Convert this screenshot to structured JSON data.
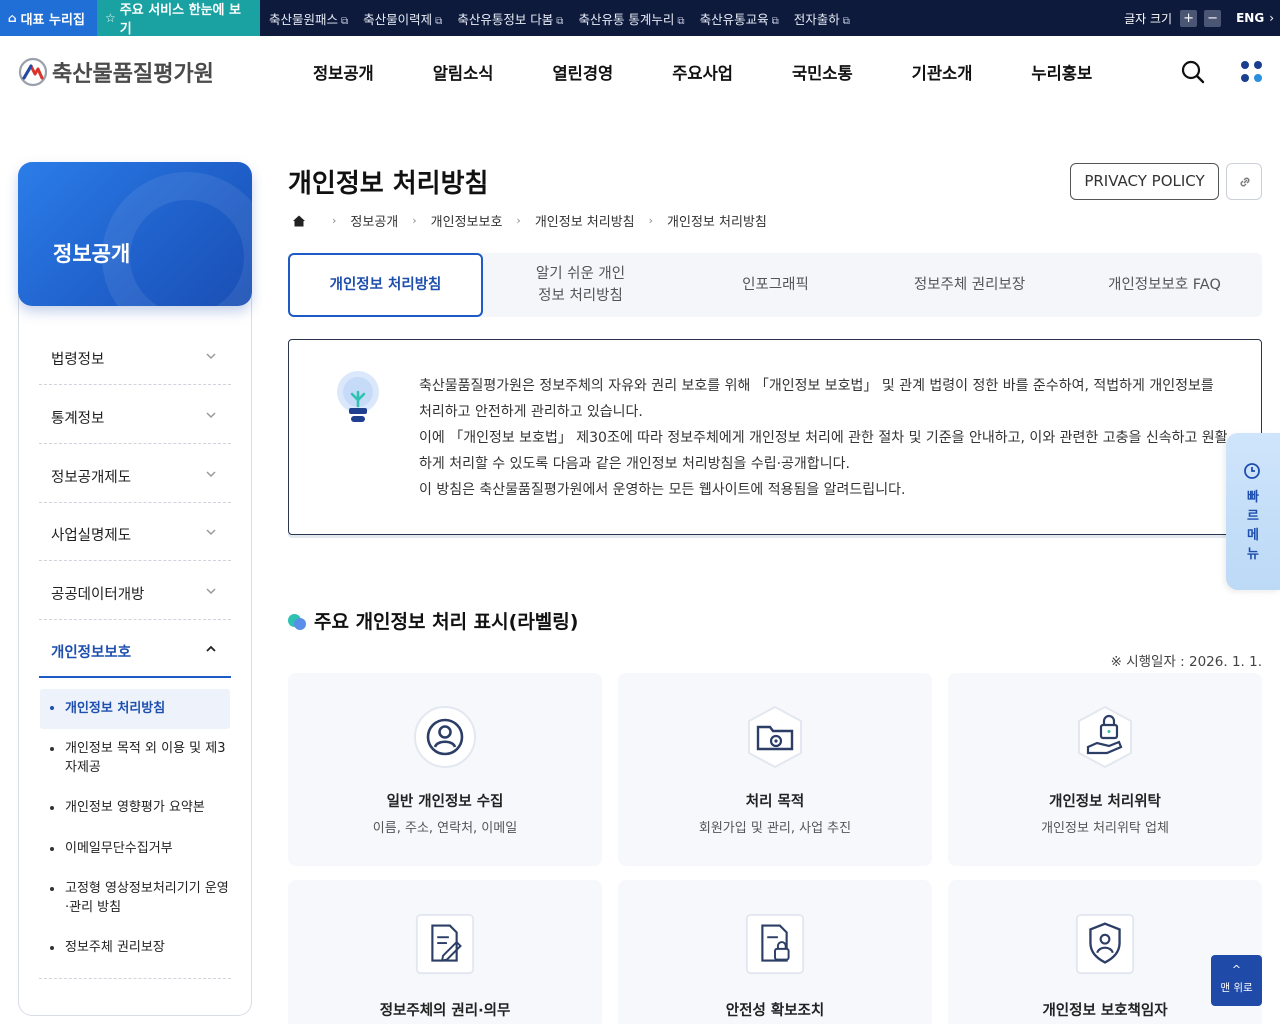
{
  "topbar": {
    "portal_main": "대표 누리집",
    "portal_services": "주요 서비스 한눈에 보기",
    "links": [
      "축산물원패스",
      "축산물이력제",
      "축산유통정보 다봄",
      "축산유통 통계누리",
      "축산유통교육",
      "전자출하"
    ],
    "font_size_label": "글자 크기",
    "font_plus": "+",
    "font_minus": "−",
    "lang": "ENG",
    "lang_arrow": "›"
  },
  "header": {
    "logo_text": "축산물품질평가원",
    "menu": [
      "정보공개",
      "알림소식",
      "열린경영",
      "주요사업",
      "국민소통",
      "기관소개",
      "누리홍보"
    ]
  },
  "sidebar": {
    "title": "정보공개",
    "items": [
      {
        "label": "법령정보"
      },
      {
        "label": "통계정보"
      },
      {
        "label": "정보공개제도"
      },
      {
        "label": "사업실명제도"
      },
      {
        "label": "공공데이터개방"
      },
      {
        "label": "개인정보보호"
      }
    ],
    "sub_items": [
      {
        "label": "개인정보 처리방침"
      },
      {
        "label": "개인정보 목적 외 이용 및 제3자제공"
      },
      {
        "label": "개인정보 영향평가 요약본"
      },
      {
        "label": "이메일무단수집거부"
      },
      {
        "label": "고정형 영상정보처리기기 운영·관리 방침"
      },
      {
        "label": "정보주체 권리보장"
      }
    ]
  },
  "main": {
    "title": "개인정보 처리방침",
    "privacy_policy_button": "PRIVACY POLICY",
    "breadcrumb": [
      "정보공개",
      "개인정보보호",
      "개인정보 처리방침",
      "개인정보 처리방침"
    ],
    "tabs": [
      {
        "label": "개인정보 처리방침"
      },
      {
        "label": "알기 쉬운 개인정보 처리방침"
      },
      {
        "label": "인포그래픽"
      },
      {
        "label": "정보주체 권리보장"
      },
      {
        "label": "개인정보보호 FAQ"
      }
    ],
    "intro_lines": [
      "축산물품질평가원은 정보주체의 자유와 권리 보호를 위해 「개인정보 보호법」 및 관계 법령이 정한 바를 준수하여, 적법하게 개인정보를 처리하고 안전하게 관리하고 있습니다.",
      "이에 「개인정보 보호법」 제30조에 따라 정보주체에게 개인정보 처리에 관한 절차 및 기준을 안내하고, 이와 관련한 고충을 신속하고 원활하게 처리할 수 있도록 다음과 같은 개인정보 처리방침을 수립·공개합니다.",
      "이 방침은 축산물품질평가원에서 운영하는 모든 웹사이트에 적용됨을 알려드립니다."
    ],
    "section_title": "주요 개인정보 처리 표시(라벨링)",
    "effective_date": "※ 시행일자 : 2026. 1. 1.",
    "cards": [
      {
        "title": "일반 개인정보 수집",
        "desc": "이름, 주소, 연락처, 이메일",
        "icon": "user-circle-icon"
      },
      {
        "title": "처리 목적",
        "desc": "회원가입 및 관리, 사업 추진",
        "icon": "folder-gear-icon"
      },
      {
        "title": "개인정보 처리위탁",
        "desc": "개인정보 처리위탁 업체",
        "icon": "hand-lock-icon"
      },
      {
        "title": "정보주체의 권리·의무",
        "desc": "",
        "icon": "document-pen-icon"
      },
      {
        "title": "안전성 확보조치",
        "desc": "",
        "icon": "document-lock-icon"
      },
      {
        "title": "개인정보 보호책임자",
        "desc": "",
        "icon": "shield-user-icon"
      }
    ]
  },
  "quick_menu": {
    "label": "빠르메뉴"
  },
  "top_button": {
    "arrow": "^",
    "label": "맨 위로"
  },
  "colors": {
    "navy": "#0e1a3c",
    "primary": "#1e5bc6",
    "teal": "#1aa2a2",
    "portal_blue": "#1f6fd6"
  }
}
